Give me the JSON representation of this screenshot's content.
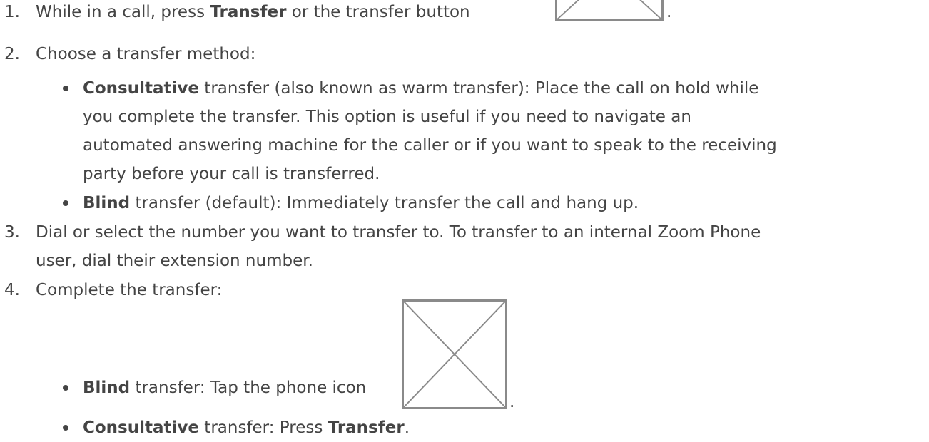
{
  "steps": [
    {
      "number": "1.",
      "before": "While in a call, press ",
      "bold": "Transfer",
      "middle": " or the transfer button ",
      "after": ".",
      "image_icon": "transfer-button-image-placeholder"
    },
    {
      "number": "2.",
      "text": "Choose a transfer method:",
      "bullets": [
        {
          "bold": "Consultative",
          "lines": [
            " transfer (also known as warm transfer): Place the call on hold while",
            "you complete the transfer. This option is useful if you need to navigate an",
            "automated answering machine for the caller or if you want to speak to the receiving",
            "party before your call is transferred."
          ]
        },
        {
          "bold": "Blind",
          "text": " transfer (default): Immediately transfer the call and hang up."
        }
      ]
    },
    {
      "number": "3.",
      "lines": [
        "Dial or select the number you want to transfer to. To transfer to an internal Zoom Phone",
        "user, dial their extension number."
      ]
    },
    {
      "number": "4.",
      "text": "Complete the transfer:",
      "bullets": [
        {
          "bold": "Blind",
          "text": " transfer: Tap the phone icon ",
          "after": ".",
          "image_icon": "phone-icon-image-placeholder"
        },
        {
          "bold": "Consultative",
          "text": " transfer: Press ",
          "bold2": "Transfer",
          "after": "."
        }
      ]
    }
  ]
}
